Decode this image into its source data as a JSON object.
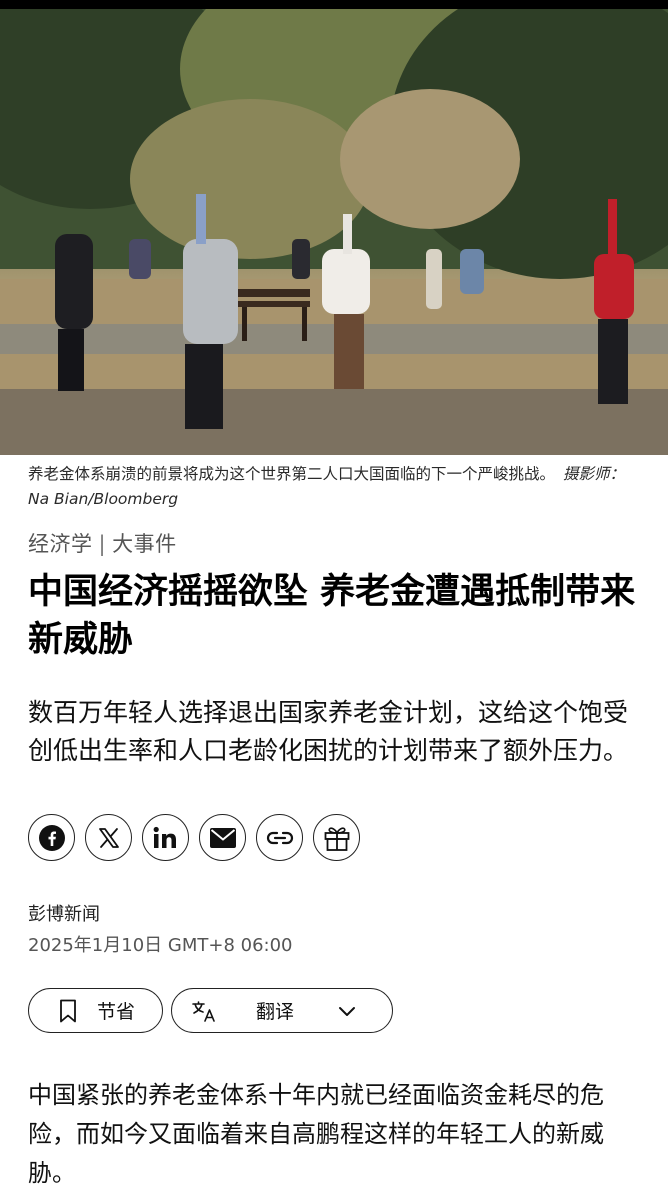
{
  "photo": {
    "caption": "养老金体系崩溃的前景将成为这个世界第二人口大国面临的下一个严峻挑战。",
    "credit": "摄影师：Na Bian/Bloomberg"
  },
  "article": {
    "section": "经济学",
    "subsection": "大事件",
    "headline": "中国经济摇摇欲坠 养老金遭遇抵制带来新威胁",
    "dek": "数百万年轻人选择退出国家养老金计划，这给这个饱受创低出生率和人口老龄化困扰的计划带来了额外压力。",
    "source": "彭博新闻",
    "date": "2025年1月10日 GMT+8 06:00",
    "body": "中国紧张的养老金体系十年内就已经面临资金耗尽的危险，而如今又面临着来自高鹏程这样的年轻工人的新威胁。"
  },
  "share_icons": [
    "facebook-icon",
    "x-icon",
    "linkedin-icon",
    "email-icon",
    "link-icon",
    "gift-icon"
  ],
  "actions": {
    "bookmark_label": "节省",
    "translate_label": "翻译"
  }
}
